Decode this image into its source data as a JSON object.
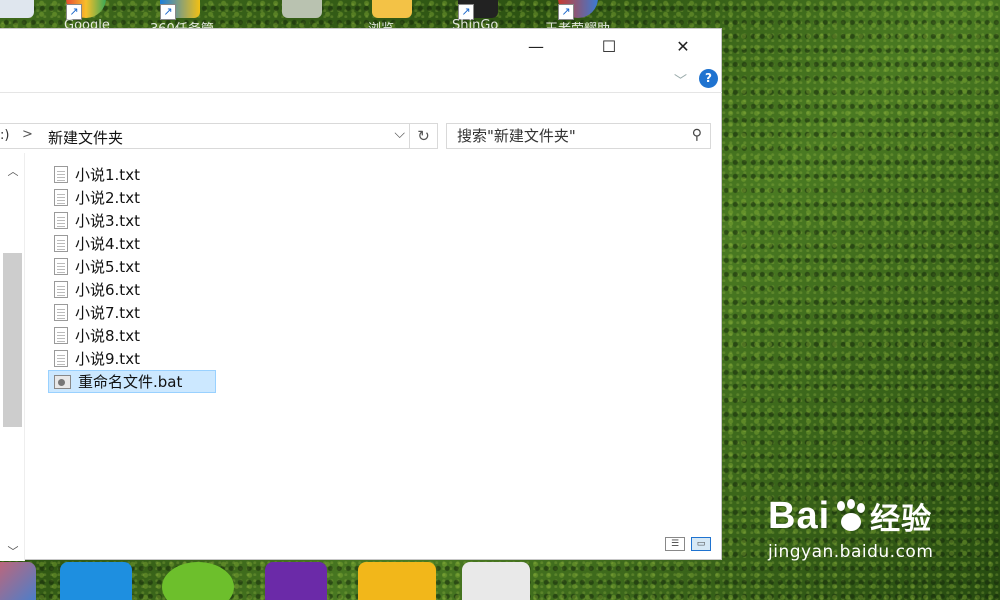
{
  "desktop": {
    "top_labels": [
      "Google",
      "360任务管",
      "浏览",
      "ShinGo",
      "王者荣耀助"
    ]
  },
  "window": {
    "controls": {
      "minimize": "—",
      "maximize": "☐",
      "close": "✕"
    },
    "help_label": "?",
    "address": {
      "prefix": ":)",
      "separator": ">",
      "path": "新建文件夹"
    },
    "search": {
      "placeholder": "搜索\"新建文件夹\""
    },
    "files": [
      {
        "name": "小说1.txt",
        "type": "txt"
      },
      {
        "name": "小说2.txt",
        "type": "txt"
      },
      {
        "name": "小说3.txt",
        "type": "txt"
      },
      {
        "name": "小说4.txt",
        "type": "txt"
      },
      {
        "name": "小说5.txt",
        "type": "txt"
      },
      {
        "name": "小说6.txt",
        "type": "txt"
      },
      {
        "name": "小说7.txt",
        "type": "txt"
      },
      {
        "name": "小说8.txt",
        "type": "txt"
      },
      {
        "name": "小说9.txt",
        "type": "txt"
      },
      {
        "name": "重命名文件.bat",
        "type": "bat",
        "selected": true
      }
    ]
  },
  "watermark": {
    "brand_left": "Bai",
    "brand_right": "经验",
    "site": "jingyan.baidu.com"
  },
  "colors": {
    "selection": "#cce8ff",
    "selection_border": "#99d1ff",
    "accent": "#1f73d0"
  }
}
